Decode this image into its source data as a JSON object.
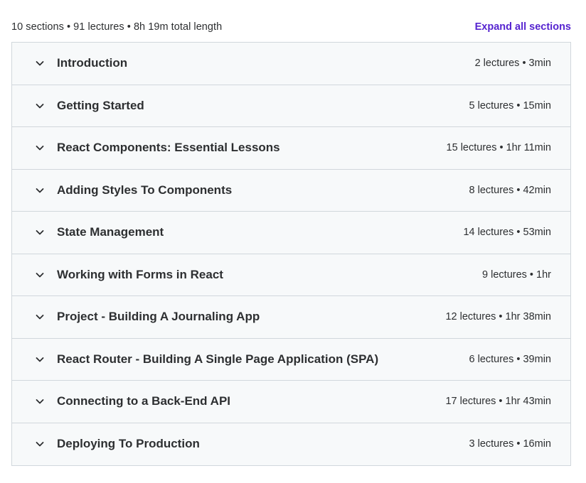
{
  "curriculum": {
    "summary": "10 sections • 91 lectures • 8h 19m total length",
    "expand_all_label": "Expand all sections",
    "accent_color": "#5624d0",
    "sections": [
      {
        "title": "Introduction",
        "meta": "2 lectures • 3min"
      },
      {
        "title": "Getting Started",
        "meta": "5 lectures • 15min"
      },
      {
        "title": "React Components: Essential Lessons",
        "meta": "15 lectures • 1hr 11min"
      },
      {
        "title": "Adding Styles To Components",
        "meta": "8 lectures • 42min"
      },
      {
        "title": "State Management",
        "meta": "14 lectures • 53min"
      },
      {
        "title": "Working with Forms in React",
        "meta": "9 lectures • 1hr"
      },
      {
        "title": "Project - Building A Journaling App",
        "meta": "12 lectures • 1hr 38min"
      },
      {
        "title": "React Router - Building A Single Page Application (SPA)",
        "meta": "6 lectures • 39min"
      },
      {
        "title": "Connecting to a Back-End API",
        "meta": "17 lectures • 1hr 43min"
      },
      {
        "title": "Deploying To Production",
        "meta": "3 lectures • 16min"
      }
    ],
    "section_icon": "chevron-down-icon"
  }
}
